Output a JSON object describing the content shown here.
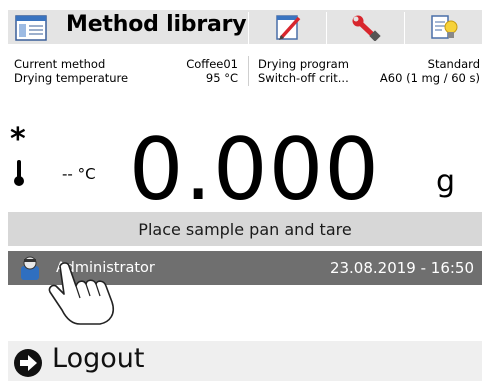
{
  "toolbar": {
    "title": "Method library",
    "icons": [
      "method-library-icon",
      "edit-notepad-icon",
      "wrench-icon",
      "thermometer-settings-icon"
    ]
  },
  "info": {
    "current_method_label": "Current method",
    "current_method_value": "Coffee01",
    "drying_temperature_label": "Drying temperature",
    "drying_temperature_value": "95 °C",
    "drying_program_label": "Drying program",
    "drying_program_value": "Standard",
    "switch_off_label": "Switch-off crit...",
    "switch_off_value": "A60  (1 mg / 60 s)"
  },
  "weighing": {
    "value": "0.000",
    "unit": "g",
    "temperature": "-- °C",
    "stability_symbol": "*"
  },
  "status": {
    "message": "Place sample pan and tare"
  },
  "user": {
    "name": "Administrator",
    "datetime": "23.08.2019 - 16:50"
  },
  "logout": {
    "label": "Logout"
  },
  "colors": {
    "toolbar_bg": "#e4e4e4",
    "status_bg": "#d7d7d7",
    "userbar_bg": "#6f6f6f",
    "logout_bg": "#efefef"
  }
}
